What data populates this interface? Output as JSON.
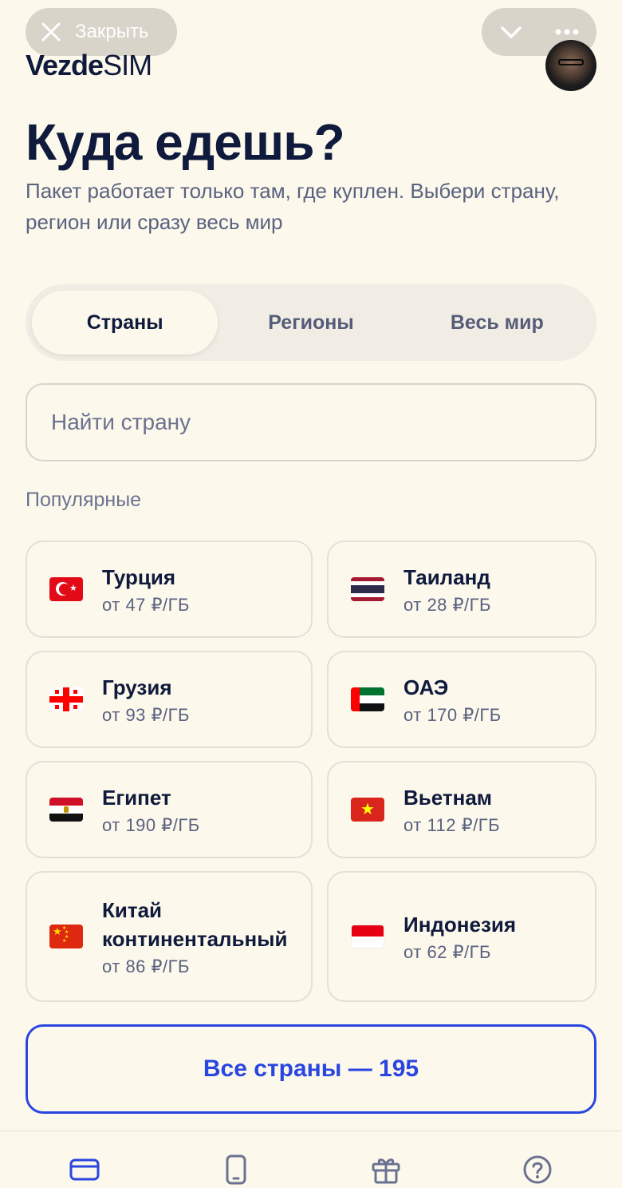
{
  "topbar": {
    "close_label": "Закрыть"
  },
  "brand": {
    "logo_bold": "Vezde",
    "logo_light": "SIM"
  },
  "header": {
    "title": "Куда едешь?",
    "subtitle": "Пакет работает только там, где куплен. Выбери страну, регион или сразу весь мир"
  },
  "tabs": [
    {
      "label": "Страны",
      "active": true
    },
    {
      "label": "Регионы",
      "active": false
    },
    {
      "label": "Весь мир",
      "active": false
    }
  ],
  "search": {
    "placeholder": "Найти страну",
    "value": ""
  },
  "popular": {
    "label": "Популярные",
    "countries": [
      {
        "name": "Турция",
        "price": "от 47 ₽/ГБ",
        "flag": "flag-turkey"
      },
      {
        "name": "Таиланд",
        "price": "от 28 ₽/ГБ",
        "flag": "flag-thailand"
      },
      {
        "name": "Грузия",
        "price": "от 93 ₽/ГБ",
        "flag": "flag-georgia"
      },
      {
        "name": "ОАЭ",
        "price": "от 170 ₽/ГБ",
        "flag": "flag-uae"
      },
      {
        "name": "Египет",
        "price": "от 190 ₽/ГБ",
        "flag": "flag-egypt"
      },
      {
        "name": "Вьетнам",
        "price": "от 112 ₽/ГБ",
        "flag": "flag-vietnam"
      },
      {
        "name_line1": "Китай",
        "name_line2": "континентальный",
        "price": "от 86 ₽/ГБ",
        "flag": "flag-china"
      },
      {
        "name": "Индонезия",
        "price": "от 62 ₽/ГБ",
        "flag": "flag-indonesia"
      }
    ]
  },
  "all_countries_button": "Все страны — 195",
  "colors": {
    "background": "#fcf8ec",
    "primary_text": "#0f1a3c",
    "secondary_text": "#5a6280",
    "accent": "#2a46e0"
  },
  "bottom_nav": [
    {
      "icon": "card-icon",
      "active": true
    },
    {
      "icon": "phone-icon",
      "active": false
    },
    {
      "icon": "gift-icon",
      "active": false
    },
    {
      "icon": "help-icon",
      "active": false
    }
  ]
}
